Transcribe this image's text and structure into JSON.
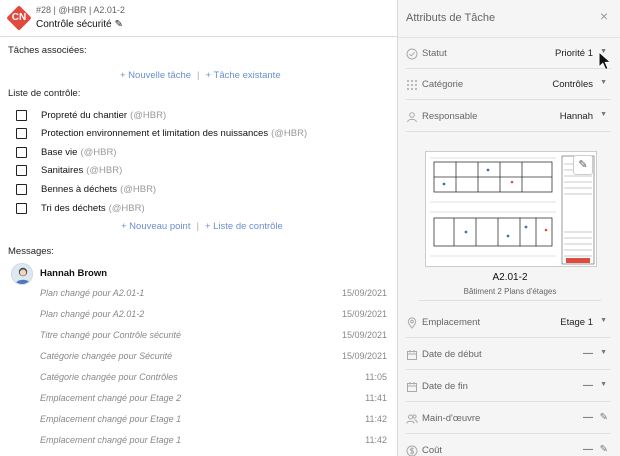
{
  "header": {
    "badge": "CN",
    "meta": "#28 | @HBR | A2.01-2",
    "title": "Contrôle sécurité"
  },
  "associated_tasks": {
    "label": "Tâches associées:",
    "new_task": "+ Nouvelle tâche",
    "existing_task": "+ Tâche existante"
  },
  "checklist": {
    "label": "Liste de contrôle:",
    "items": [
      {
        "text": "Propreté du chantier",
        "tag": "(@HBR)"
      },
      {
        "text": "Protection environnement et limitation des nuissances",
        "tag": "(@HBR)"
      },
      {
        "text": "Base vie",
        "tag": "(@HBR)"
      },
      {
        "text": "Sanitaires",
        "tag": "(@HBR)"
      },
      {
        "text": "Bennes à déchets",
        "tag": "(@HBR)"
      },
      {
        "text": "Tri des déchets",
        "tag": "(@HBR)"
      }
    ],
    "new_point": "+ Nouveau point",
    "checklist_link": "+ Liste de contrôle"
  },
  "messages": {
    "label": "Messages:",
    "author": "Hannah Brown",
    "items": [
      {
        "text": "Plan changé pour A2.01-1",
        "date": "15/09/2021"
      },
      {
        "text": "Plan changé pour A2.01-2",
        "date": "15/09/2021"
      },
      {
        "text": "Titre changé pour Contrôle sécurité",
        "date": "15/09/2021"
      },
      {
        "text": "Catégorie changée pour Sécurité",
        "date": "15/09/2021"
      },
      {
        "text": "Catégorie changée pour Contrôles",
        "date": "11:05"
      },
      {
        "text": "Emplacement changé pour Etage 2",
        "date": "11:41"
      },
      {
        "text": "Emplacement changé pour Etage 1",
        "date": "11:42"
      },
      {
        "text": "Emplacement changé pour Etage 1",
        "date": "11:42"
      }
    ]
  },
  "attributes": {
    "title": "Attributs de Tâche",
    "close": "×",
    "statut": {
      "label": "Statut",
      "value": "Priorité 1"
    },
    "categorie": {
      "label": "Catégorie",
      "value": "Contrôles"
    },
    "responsable": {
      "label": "Responsable",
      "value": "Hannah"
    },
    "plan": {
      "name": "A2.01-2",
      "subtitle": "Bâtiment 2 Plans d'étages"
    },
    "emplacement": {
      "label": "Emplacement",
      "value": "Etage 1"
    },
    "date_debut": {
      "label": "Date de début",
      "value": "—"
    },
    "date_fin": {
      "label": "Date de fin",
      "value": "—"
    },
    "main_oeuvre": {
      "label": "Main-d'œuvre",
      "value": "—"
    },
    "cout": {
      "label": "Coût",
      "value": "—"
    }
  },
  "colors": {
    "badge": "#e04b3f",
    "link": "#6a8fd0",
    "panel_bg": "#f5f5f5"
  }
}
